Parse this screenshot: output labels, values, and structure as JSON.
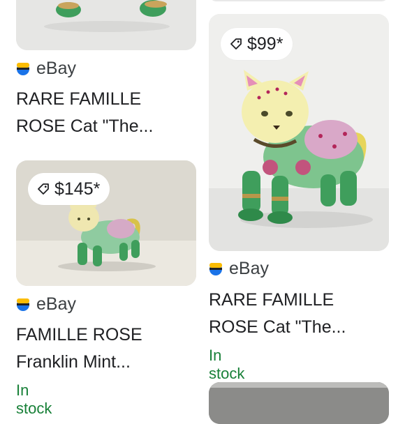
{
  "results": [
    {
      "source": "eBay",
      "title_line1": "RARE FAMILLE",
      "title_line2": "ROSE Cat \"The..."
    },
    {
      "price": "$99*",
      "source": "eBay",
      "title_line1": "RARE FAMILLE",
      "title_line2": "ROSE Cat \"The...",
      "stock": "In stock"
    },
    {
      "price": "$145*",
      "source": "eBay",
      "title_line1": "FAMILLE ROSE",
      "title_line2": "Franklin Mint...",
      "stock": "In stock"
    }
  ],
  "icons": {
    "price_tag": "tag-icon",
    "source_logo": "ebay-logo-icon"
  },
  "colors": {
    "stock": "#188038",
    "text": "#202124",
    "logo_blue": "#1a73e8",
    "logo_yellow": "#fbbc04"
  }
}
